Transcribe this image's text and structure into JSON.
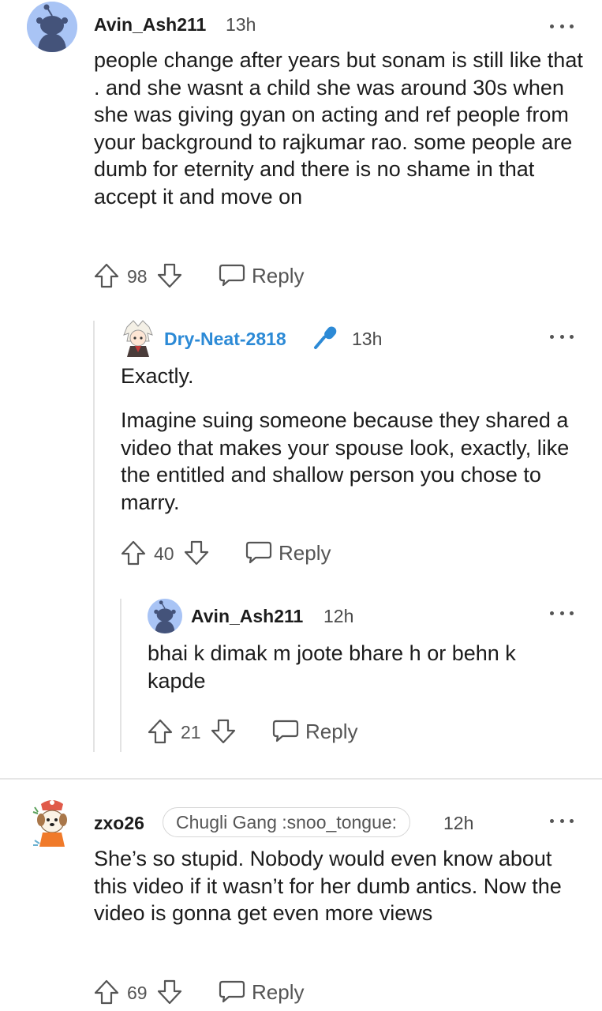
{
  "comments": [
    {
      "username": "Avin_Ash211",
      "time": "13h",
      "body": "people change after years but sonam is still like that . and she wasnt a child she was around 30s when she was giving gyan on acting and ref people from your background to rajkumar rao. some people are dumb for eternity and there is no shame in that accept it and move on",
      "votes": "98",
      "reply_label": "Reply",
      "avatar_icon": "snoo-avatar-icon"
    },
    {
      "username": "Dry-Neat-2818",
      "time": "13h",
      "body_p1": "Exactly.",
      "body_p2": "Imagine suing someone because they shared a video that makes your spouse look, exactly, like the entitled and shallow person you chose to marry.",
      "votes": "40",
      "reply_label": "Reply",
      "badge_icon": "microphone-icon",
      "username_color": "#2c8ad6"
    },
    {
      "username": "Avin_Ash211",
      "time": "12h",
      "body": "bhai k dimak m joote bhare h or behn k kapde",
      "votes": "21",
      "reply_label": "Reply"
    },
    {
      "username": "zxo26",
      "flair": "Chugli Gang :snoo_tongue:",
      "time": "12h",
      "body": "She’s so stupid. Nobody would even know about this video if it wasn’t for her dumb antics. Now the video is gonna get even more views",
      "votes": "69",
      "reply_label": "Reply"
    }
  ]
}
